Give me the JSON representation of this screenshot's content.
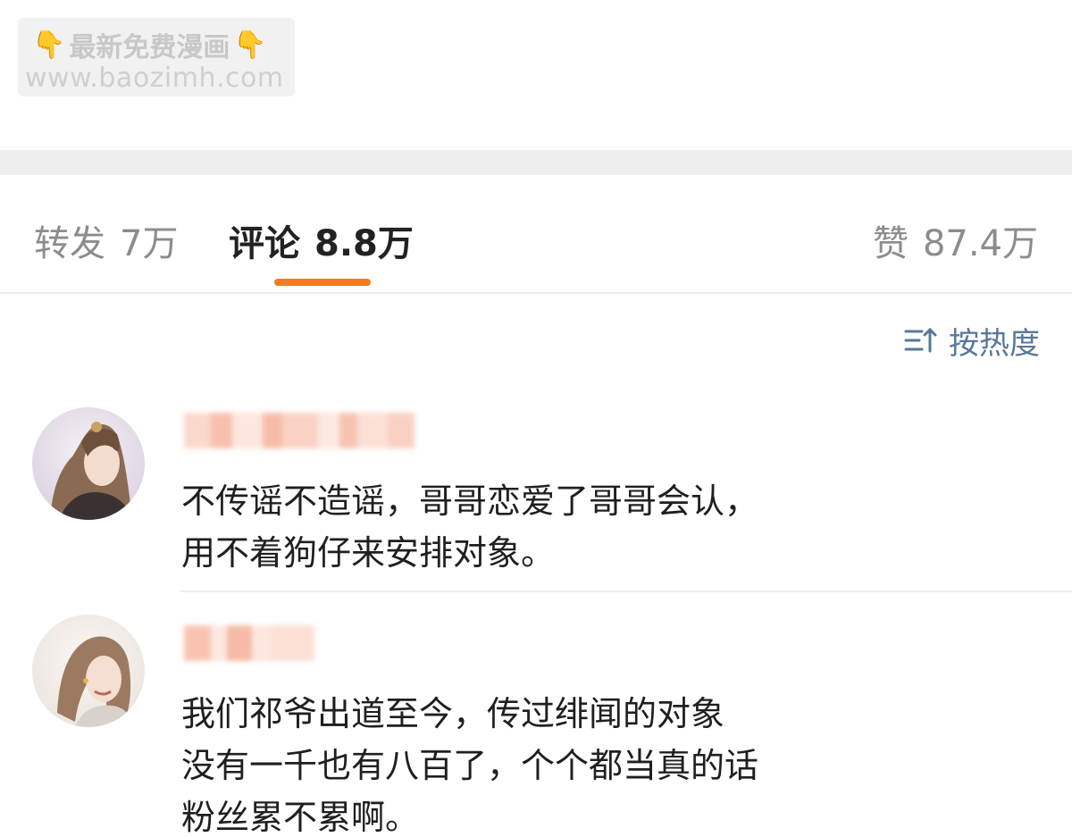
{
  "watermark": {
    "line1": "最新免费漫画",
    "line2": "www.baozimh.com",
    "hand_icon": "pointing-down-hand"
  },
  "tabs": {
    "repost": {
      "label": "转发",
      "count": "7万"
    },
    "comment": {
      "label": "评论",
      "count": "8.8万"
    },
    "like": {
      "label": "赞",
      "count": "87.4万"
    },
    "accent_color": "#f07c24"
  },
  "sort": {
    "label": "按热度",
    "icon": "sort-icon",
    "color": "#59779a"
  },
  "comments": [
    {
      "lines": [
        "不传谣不造谣，哥哥恋爱了哥哥会认，",
        "用不着狗仔来安排对象。"
      ]
    },
    {
      "lines": [
        "我们祁爷出道至今，传过绯闻的对象",
        "没有一千也有八百了，个个都当真的话",
        "粉丝累不累啊。"
      ]
    }
  ]
}
